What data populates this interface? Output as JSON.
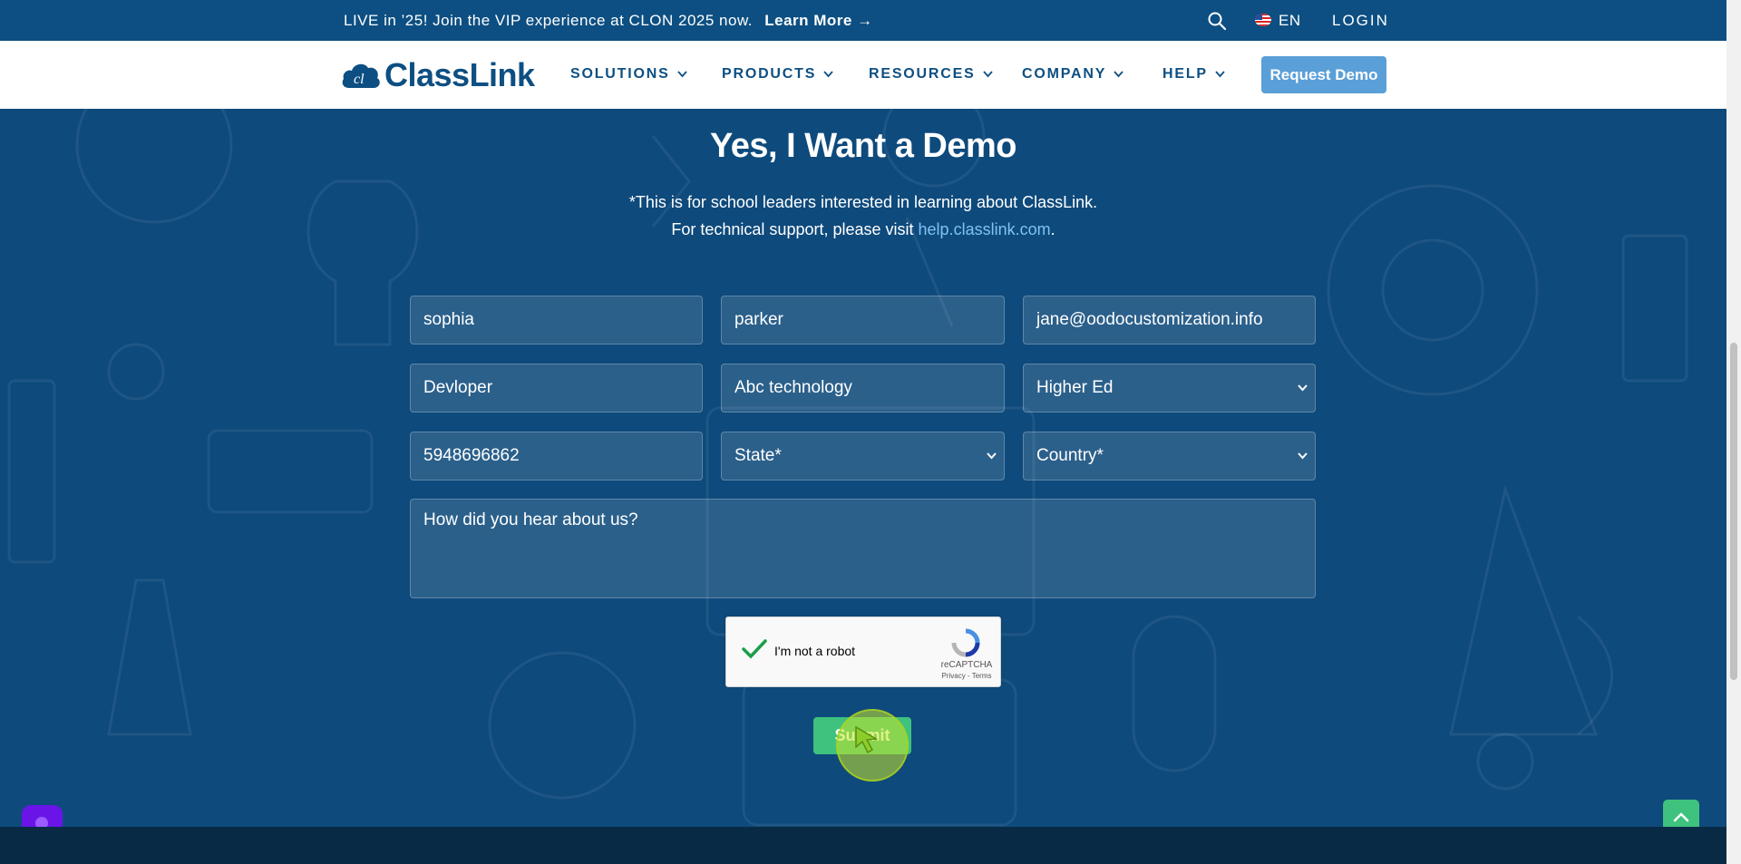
{
  "announcement": {
    "text": "LIVE in ’25! Join the VIP experience at CLON 2025 now.",
    "link": "Learn More →",
    "language": "EN",
    "login": "LOGIN"
  },
  "nav": {
    "brand": "ClassLink",
    "items": [
      "SOLUTIONS",
      "PRODUCTS",
      "RESOURCES",
      "COMPANY",
      "HELP"
    ],
    "cta": "Request Demo"
  },
  "hero": {
    "title": "Yes, I Want a Demo",
    "line1": "*This is for school leaders interested in learning about ClassLink.",
    "line2_prefix": "For technical support, please visit ",
    "line2_link": "help.classlink.com",
    "line2_suffix": "."
  },
  "form": {
    "first_name": "sophia",
    "last_name": "parker",
    "email": "jane@oodocustomization.info",
    "job_title": "Devloper",
    "organization": "Abc technology",
    "segment": "Higher Ed",
    "phone": "5948696862",
    "state": "State*",
    "country": "Country*",
    "hear_about_placeholder": "How did you hear about us?",
    "captcha_label": "I'm not a robot",
    "captcha_brand": "reCAPTCHA",
    "captcha_terms": "Privacy - Terms",
    "submit": "Submit"
  },
  "colors": {
    "brand_blue": "#0d4f82",
    "cta_blue": "#5a9fd8",
    "submit_green": "#3ec27e",
    "link_blue": "#7fc3f2"
  },
  "icons": {
    "search": "search-icon",
    "flag": "us-flag-icon",
    "chevron": "chevron-down-icon",
    "scroll_top": "chevron-up-icon",
    "chat": "chat-icon"
  }
}
